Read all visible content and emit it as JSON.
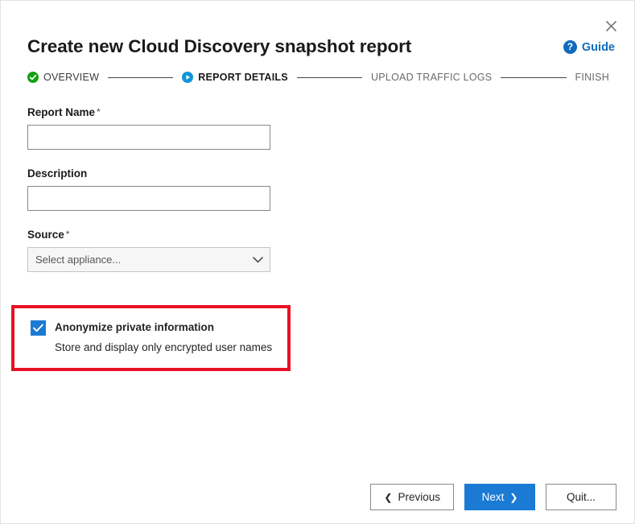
{
  "window": {
    "title": "Create new Cloud Discovery snapshot report",
    "close_label": "×",
    "close_icon": "close-icon"
  },
  "guide": {
    "label": "Guide",
    "icon_glyph": "?",
    "icon": "question-circle-icon",
    "color": "#0f6cbd"
  },
  "stepper": {
    "steps": [
      {
        "label": "OVERVIEW",
        "state": "done",
        "icon": "check-circle-icon",
        "color": "#10a010"
      },
      {
        "label": "REPORT DETAILS",
        "state": "current",
        "icon": "play-circle-icon",
        "color": "#0f94d9"
      },
      {
        "label": "UPLOAD TRAFFIC LOGS",
        "state": "upcoming",
        "icon": "none",
        "color": "#6b6b6b"
      },
      {
        "label": "FINISH",
        "state": "upcoming",
        "icon": "none",
        "color": "#6b6b6b"
      }
    ]
  },
  "form": {
    "report_name": {
      "label": "Report Name",
      "required_mark": "*",
      "value": "",
      "placeholder": ""
    },
    "description": {
      "label": "Description",
      "required_mark": "",
      "value": "",
      "placeholder": ""
    },
    "source": {
      "label": "Source",
      "required_mark": "*",
      "selected": "Select appliance...",
      "chevron_icon": "chevron-down-icon"
    }
  },
  "anonymize": {
    "checked": true,
    "label": "Anonymize private information",
    "sublabel": "Store and display only encrypted user names",
    "highlight_color": "#e81123",
    "checkbox_color": "#1b7ad4",
    "check_icon": "checkmark-icon"
  },
  "footer": {
    "previous": {
      "label": "Previous",
      "arrow": "❮"
    },
    "next": {
      "label": "Next",
      "arrow": "❯"
    },
    "quit": {
      "label": "Quit..."
    }
  }
}
